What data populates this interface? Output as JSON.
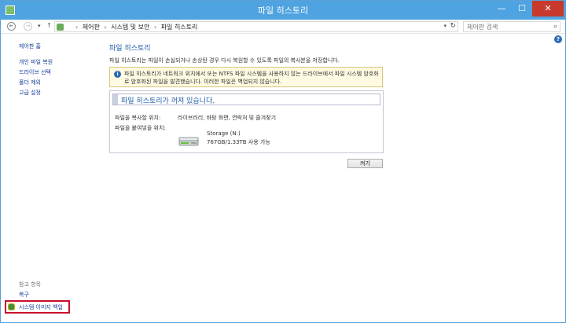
{
  "window": {
    "title": "파일 히스토리",
    "min_glyph": "—",
    "max_glyph": "☐",
    "close_glyph": "✕"
  },
  "address": {
    "back_glyph": "←",
    "forward_glyph": "→",
    "recent_glyph": "▾",
    "up_glyph": "↑",
    "breadcrumbs": [
      "제어판",
      "시스템 및 보안",
      "파일 히스토리"
    ],
    "separator": "›",
    "dropdown_glyph": "▾",
    "refresh_glyph": "↻"
  },
  "search": {
    "placeholder": "제어판 검색",
    "icon": "search-icon",
    "glyph": "⌕"
  },
  "help": {
    "icon": "help-icon",
    "glyph": "?"
  },
  "sidebar": {
    "home": "제어판 홈",
    "items": [
      "개인 파일 복원",
      "드라이브 선택",
      "폴더 제외",
      "고급 설정"
    ],
    "see_also_heading": "참고 항목",
    "see_also": [
      "복구"
    ],
    "system_image_backup": "시스템 이미지 백업"
  },
  "main": {
    "title": "파일 히스토리",
    "description": "파일 히스토리는 파일이 손실되거나 손상된 경우 다시 복원할 수 있도록 파일의 복사본을 저장합니다.",
    "info_glyph": "i",
    "info_message": "파일 히스토리가 네트워크 위치에서 또는 NTFS 파일 시스템을 사용하지 않는 드라이브에서 파일 시스템 암호화로 암호화된 파일을 발견했습니다. 이러한 파일은 백업되지 않습니다.",
    "status_title": "파일 히스토리가 꺼져 있습니다.",
    "copy_from_label": "파일을 복사할 위치:",
    "copy_from_value": "라이브러리, 바탕 화면, 연락처 및 즐겨찾기",
    "copy_to_label": "파일을 붙여넣을 위치:",
    "drive_name": "Storage (N:)",
    "drive_size": "767GB/1.33TB 사용 가능",
    "turn_on_label": "켜기"
  },
  "colors": {
    "titlebar": "#4fa3e0",
    "link": "#1a3f9d",
    "heading": "#1e5ba8",
    "highlight_border": "#c8102e",
    "info_bg": "#fffbe3"
  }
}
